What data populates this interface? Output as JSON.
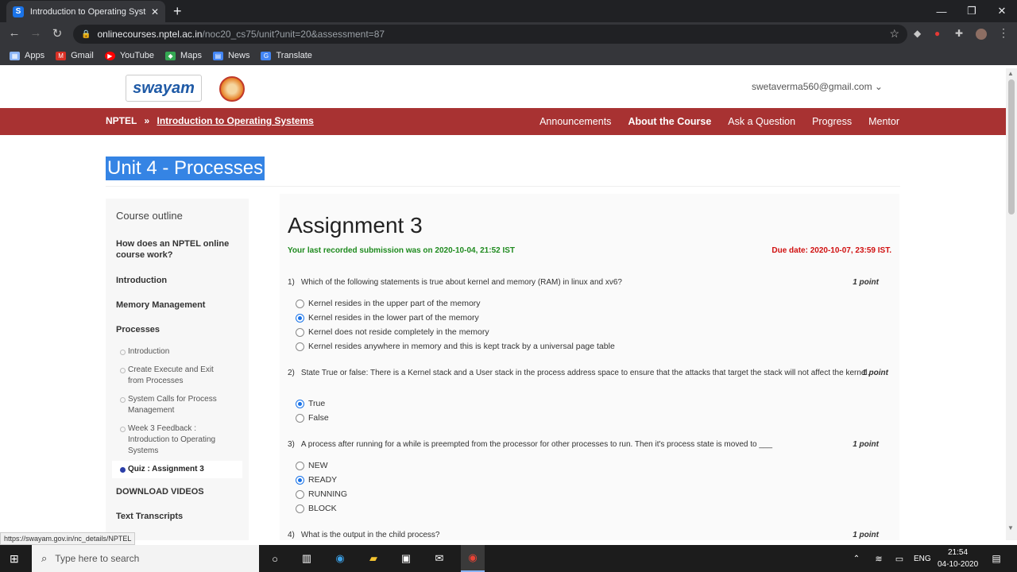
{
  "browser": {
    "tab_title": "Introduction to Operating Systems",
    "tab_favicon": "S",
    "url_host": "onlinecourses.nptel.ac.in",
    "url_path": "/noc20_cs75/unit?unit=20&assessment=87",
    "bookmarks": [
      {
        "label": "Apps",
        "color": "#8ab4f8"
      },
      {
        "label": "Gmail",
        "color": "#d93025"
      },
      {
        "label": "YouTube",
        "color": "#ff0000"
      },
      {
        "label": "Maps",
        "color": "#34a853"
      },
      {
        "label": "News",
        "color": "#4285f4"
      },
      {
        "label": "Translate",
        "color": "#4285f4"
      }
    ],
    "status_url": "https://swayam.gov.in/nc_details/NPTEL"
  },
  "header": {
    "logo_text": "swayam",
    "user_email": "swetaverma560@gmail.com ⌄"
  },
  "nav": {
    "root": "NPTEL",
    "sep": "»",
    "course": "Introduction to Operating Systems",
    "items": [
      "Announcements",
      "About the Course",
      "Ask a Question",
      "Progress",
      "Mentor"
    ],
    "active_index": 1,
    "accent_color": "#a83232"
  },
  "unit_title": "Unit 4 - Processes",
  "sidebar": {
    "title": "Course outline",
    "items": [
      "How does an NPTEL online course work?",
      "Introduction",
      "Memory Management",
      "Processes"
    ],
    "sub_items": [
      "Introduction",
      "Create Execute and Exit from Processes",
      "System Calls for Process Management",
      "Week 3 Feedback : Introduction to Operating Systems",
      "Quiz : Assignment 3"
    ],
    "more_items": [
      "DOWNLOAD VIDEOS",
      "Text Transcripts"
    ]
  },
  "assignment": {
    "title": "Assignment 3",
    "last_submission": "Your last recorded submission was on 2020-10-04, 21:52 IST",
    "due": "Due date: 2020-10-07, 23:59 IST.",
    "points_label": "1 point",
    "questions": [
      {
        "num": "1)",
        "text": "Which of the following statements is true about kernel and memory (RAM) in linux and xv6?",
        "options": [
          "Kernel resides in the upper part of the memory",
          "Kernel resides in the lower part of the memory",
          "Kernel does not reside completely in the memory",
          "Kernel resides anywhere in memory and this is kept track by a universal page table"
        ],
        "selected": 1
      },
      {
        "num": "2)",
        "text": "State True or false: There is a Kernel stack and a User stack in the process address space to ensure that the attacks that target the stack will not affect the kernel.",
        "options": [
          "True",
          "False"
        ],
        "selected": 0
      },
      {
        "num": "3)",
        "text": "A process after running for a while is preempted from the processor for other processes to run. Then it's process state is moved to ___",
        "options": [
          "NEW",
          "READY",
          "RUNNING",
          "BLOCK"
        ],
        "selected": 1
      },
      {
        "num": "4)",
        "text": "What is the output in the child process?"
      }
    ]
  },
  "taskbar": {
    "search_placeholder": "Type here to search",
    "lang": "ENG",
    "time": "21:54",
    "date": "04-10-2020"
  }
}
